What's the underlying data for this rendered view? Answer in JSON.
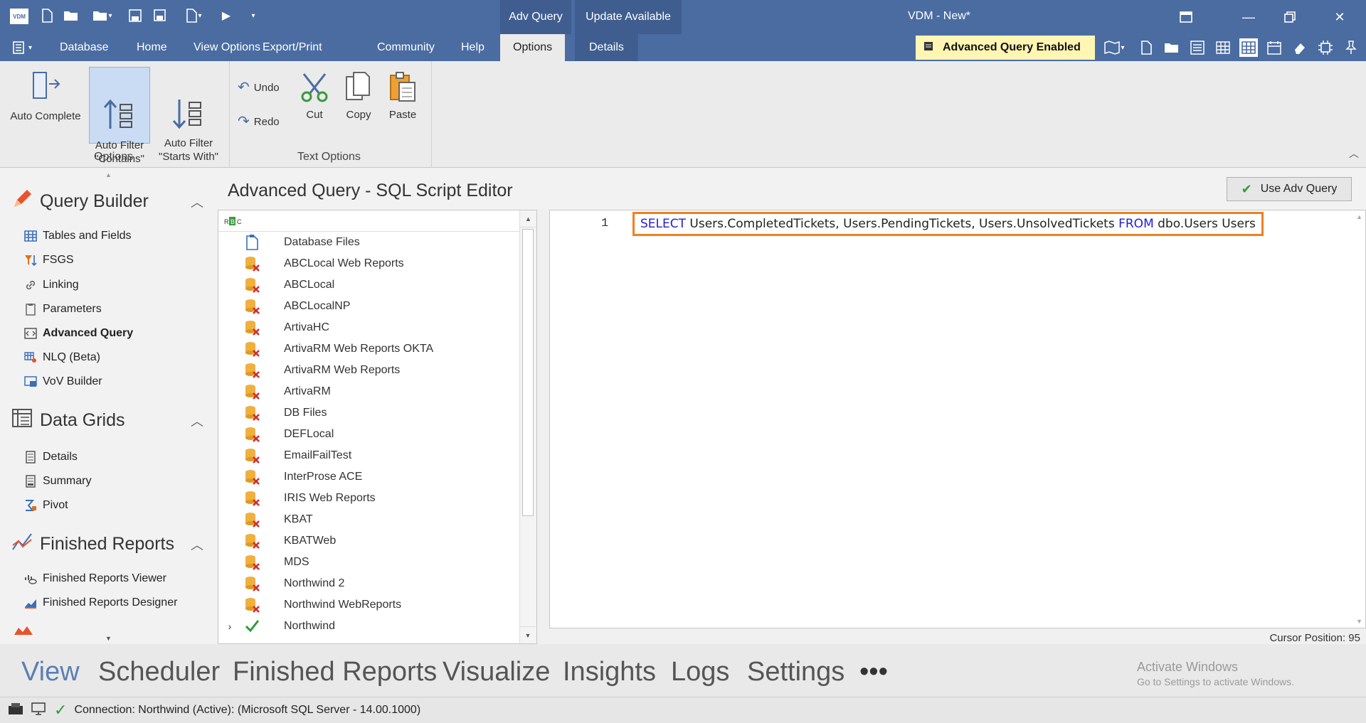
{
  "titlebar": {
    "window_title": "VDM - New*",
    "context_tabs": [
      "Adv Query",
      "Update Available"
    ]
  },
  "menubar": {
    "items": [
      "Database",
      "Home",
      "View Options",
      "Export/Print",
      "Community",
      "Help",
      "Options",
      "Details"
    ],
    "badge": "Advanced Query Enabled"
  },
  "ribbon": {
    "options_buttons": [
      "Auto Complete",
      "Auto Filter\n\"Contains\"",
      "Auto Filter\n\"Starts With\""
    ],
    "text_buttons": [
      "Undo",
      "Redo",
      "Cut",
      "Copy",
      "Paste"
    ],
    "group_labels": [
      "Options",
      "Text Options"
    ]
  },
  "sidebar": {
    "sections": [
      {
        "title": "Query Builder",
        "items": [
          "Tables and Fields",
          "FSGS",
          "Linking",
          "Parameters",
          "Advanced Query",
          "NLQ (Beta)",
          "VoV Builder"
        ]
      },
      {
        "title": "Data Grids",
        "items": [
          "Details",
          "Summary",
          "Pivot"
        ]
      },
      {
        "title": "Finished Reports",
        "items": [
          "Finished Reports Viewer",
          "Finished Reports Designer"
        ]
      }
    ]
  },
  "editor": {
    "title": "Advanced Query - SQL Script Editor",
    "use_adv_button": "Use Adv Query",
    "line_number": "1",
    "sql": {
      "kw1": "SELECT",
      "part1": " Users.CompletedTickets, Users.PendingTickets, Users.UnsolvedTickets ",
      "kw2": "FROM",
      "part2": " dbo.Users Users"
    },
    "cursor_position": "Cursor Position: 95"
  },
  "databases": [
    {
      "name": "Database Files",
      "kind": "file"
    },
    {
      "name": "ABCLocal Web Reports",
      "kind": "error"
    },
    {
      "name": "ABCLocal",
      "kind": "error"
    },
    {
      "name": "ABCLocalNP",
      "kind": "error"
    },
    {
      "name": "ArtivaHC",
      "kind": "error"
    },
    {
      "name": "ArtivaRM Web Reports OKTA",
      "kind": "error"
    },
    {
      "name": "ArtivaRM Web Reports",
      "kind": "error"
    },
    {
      "name": "ArtivaRM",
      "kind": "error"
    },
    {
      "name": "DB Files",
      "kind": "error"
    },
    {
      "name": "DEFLocal",
      "kind": "error"
    },
    {
      "name": "EmailFailTest",
      "kind": "error"
    },
    {
      "name": "InterProse ACE",
      "kind": "error"
    },
    {
      "name": "IRIS Web Reports",
      "kind": "error"
    },
    {
      "name": "KBAT",
      "kind": "error"
    },
    {
      "name": "KBATWeb",
      "kind": "error"
    },
    {
      "name": "MDS",
      "kind": "error"
    },
    {
      "name": "Northwind 2",
      "kind": "error"
    },
    {
      "name": "Northwind WebReports",
      "kind": "error"
    },
    {
      "name": "Northwind",
      "kind": "ok"
    }
  ],
  "bottom_nav": [
    "View",
    "Scheduler",
    "Finished Reports",
    "Visualize",
    "Insights",
    "Logs",
    "Settings",
    "•••"
  ],
  "activate_windows": {
    "line1": "Activate Windows",
    "line2": "Go to Settings to activate Windows."
  },
  "status": {
    "connection": "Connection: Northwind (Active): (Microsoft SQL Server - 14.00.1000)"
  },
  "colors": {
    "titlebar": "#4a6ca1",
    "badge_bg": "#fff6b3",
    "highlight_border": "#f08020",
    "sql_keyword": "#1f1fd6"
  }
}
